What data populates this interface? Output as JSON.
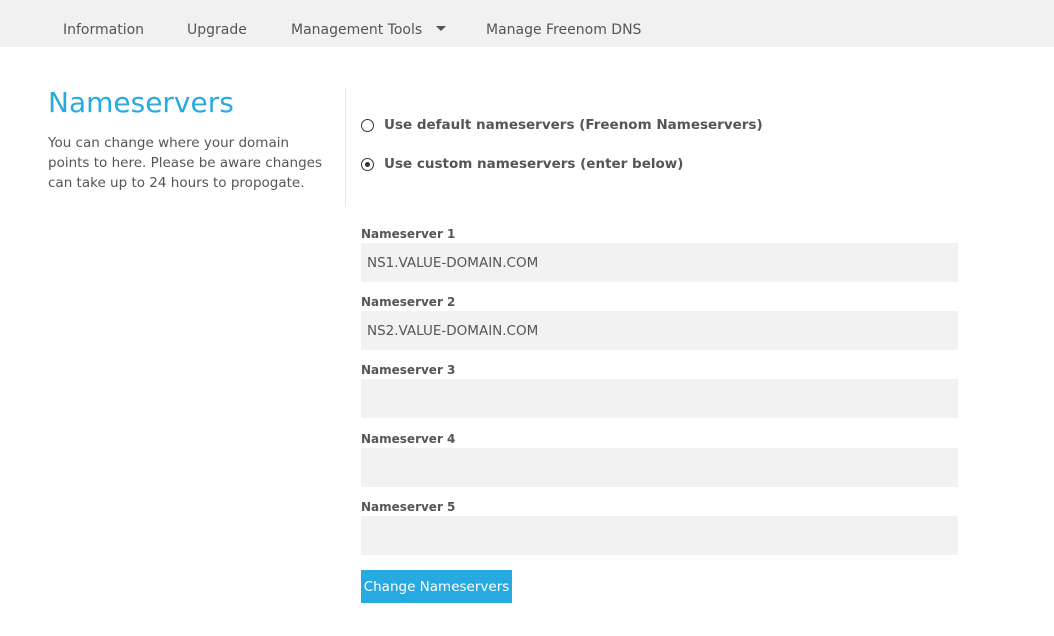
{
  "nav": {
    "items": [
      {
        "label": "Information"
      },
      {
        "label": "Upgrade"
      },
      {
        "label": "Management Tools"
      },
      {
        "label": "Manage Freenom DNS"
      }
    ]
  },
  "section": {
    "title": "Nameservers",
    "description": "You can change where your domain points to here. Please be aware changes can take up to 24 hours to propogate."
  },
  "options": {
    "default_label": "Use default nameservers (Freenom Nameservers)",
    "custom_label": "Use custom nameservers (enter below)",
    "selected": "custom"
  },
  "nameservers": [
    {
      "label": "Nameserver 1",
      "value": "NS1.VALUE-DOMAIN.COM"
    },
    {
      "label": "Nameserver 2",
      "value": "NS2.VALUE-DOMAIN.COM"
    },
    {
      "label": "Nameserver 3",
      "value": ""
    },
    {
      "label": "Nameserver 4",
      "value": ""
    },
    {
      "label": "Nameserver 5",
      "value": ""
    }
  ],
  "submit_label": "Change Nameservers",
  "colors": {
    "accent": "#27aae1",
    "nav_bg": "#f1f1f1",
    "field_bg": "#f2f2f2"
  }
}
